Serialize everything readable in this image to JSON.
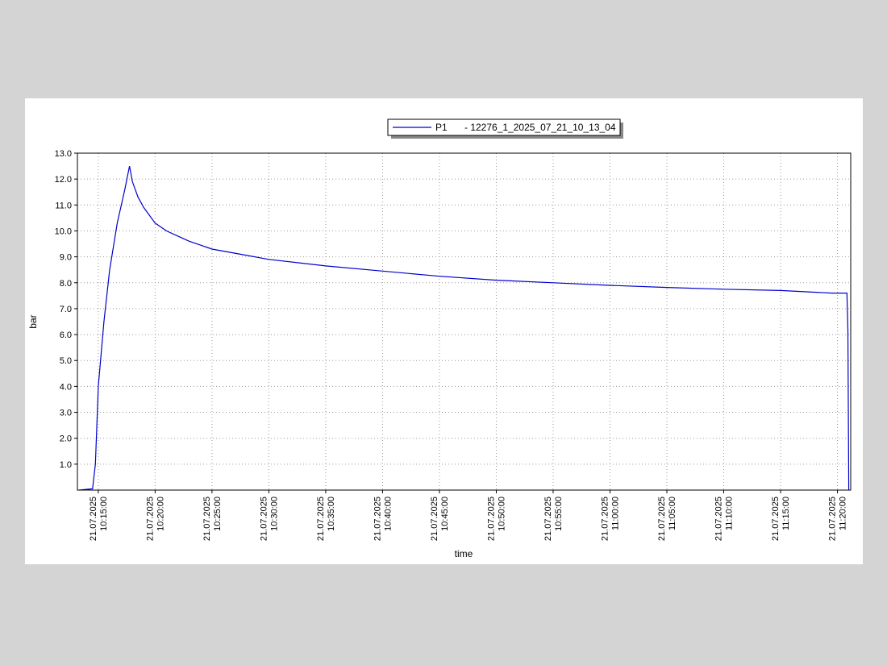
{
  "chart_data": {
    "type": "line",
    "xlabel": "time",
    "ylabel": "bar",
    "ylim": [
      0,
      13
    ],
    "xlim": [
      "21.07.2025 10:13:10",
      "21.07.2025 11:21:10"
    ],
    "y_ticks": [
      "1.0",
      "2.0",
      "3.0",
      "4.0",
      "5.0",
      "6.0",
      "7.0",
      "8.0",
      "9.0",
      "10.0",
      "11.0",
      "12.0",
      "13.0"
    ],
    "x_ticks": [
      {
        "date": "21.07.2025",
        "time": "10:15:00"
      },
      {
        "date": "21.07.2025",
        "time": "10:20:00"
      },
      {
        "date": "21.07.2025",
        "time": "10:25:00"
      },
      {
        "date": "21.07.2025",
        "time": "10:30:00"
      },
      {
        "date": "21.07.2025",
        "time": "10:35:00"
      },
      {
        "date": "21.07.2025",
        "time": "10:40:00"
      },
      {
        "date": "21.07.2025",
        "time": "10:45:00"
      },
      {
        "date": "21.07.2025",
        "time": "10:50:00"
      },
      {
        "date": "21.07.2025",
        "time": "10:55:00"
      },
      {
        "date": "21.07.2025",
        "time": "11:00:00"
      },
      {
        "date": "21.07.2025",
        "time": "11:05:00"
      },
      {
        "date": "21.07.2025",
        "time": "11:10:00"
      },
      {
        "date": "21.07.2025",
        "time": "11:15:00"
      },
      {
        "date": "21.07.2025",
        "time": "11:20:00"
      }
    ],
    "grid": true,
    "legend_position": "top-center",
    "series": [
      {
        "name": "P1",
        "legend_suffix": "- 12276_1_2025_07_21_10_13_04",
        "color": "#0000cc",
        "points": [
          [
            "10:13:20",
            0.0
          ],
          [
            "10:14:30",
            0.05
          ],
          [
            "10:14:45",
            1.0
          ],
          [
            "10:15:00",
            4.0
          ],
          [
            "10:15:30",
            6.5
          ],
          [
            "10:16:00",
            8.5
          ],
          [
            "10:16:40",
            10.3
          ],
          [
            "10:17:20",
            11.6
          ],
          [
            "10:17:45",
            12.5
          ],
          [
            "10:18:00",
            11.9
          ],
          [
            "10:18:30",
            11.3
          ],
          [
            "10:19:00",
            10.9
          ],
          [
            "10:20:00",
            10.3
          ],
          [
            "10:21:00",
            10.0
          ],
          [
            "10:22:00",
            9.8
          ],
          [
            "10:23:00",
            9.6
          ],
          [
            "10:25:00",
            9.3
          ],
          [
            "10:27:30",
            9.1
          ],
          [
            "10:30:00",
            8.9
          ],
          [
            "10:35:00",
            8.65
          ],
          [
            "10:40:00",
            8.45
          ],
          [
            "10:45:00",
            8.25
          ],
          [
            "10:50:00",
            8.1
          ],
          [
            "10:55:00",
            8.0
          ],
          [
            "11:00:00",
            7.9
          ],
          [
            "11:05:00",
            7.82
          ],
          [
            "11:10:00",
            7.75
          ],
          [
            "11:15:00",
            7.7
          ],
          [
            "11:19:30",
            7.6
          ],
          [
            "11:20:50",
            7.6
          ],
          [
            "11:20:55",
            6.2
          ],
          [
            "11:21:00",
            0.0
          ]
        ]
      }
    ]
  }
}
